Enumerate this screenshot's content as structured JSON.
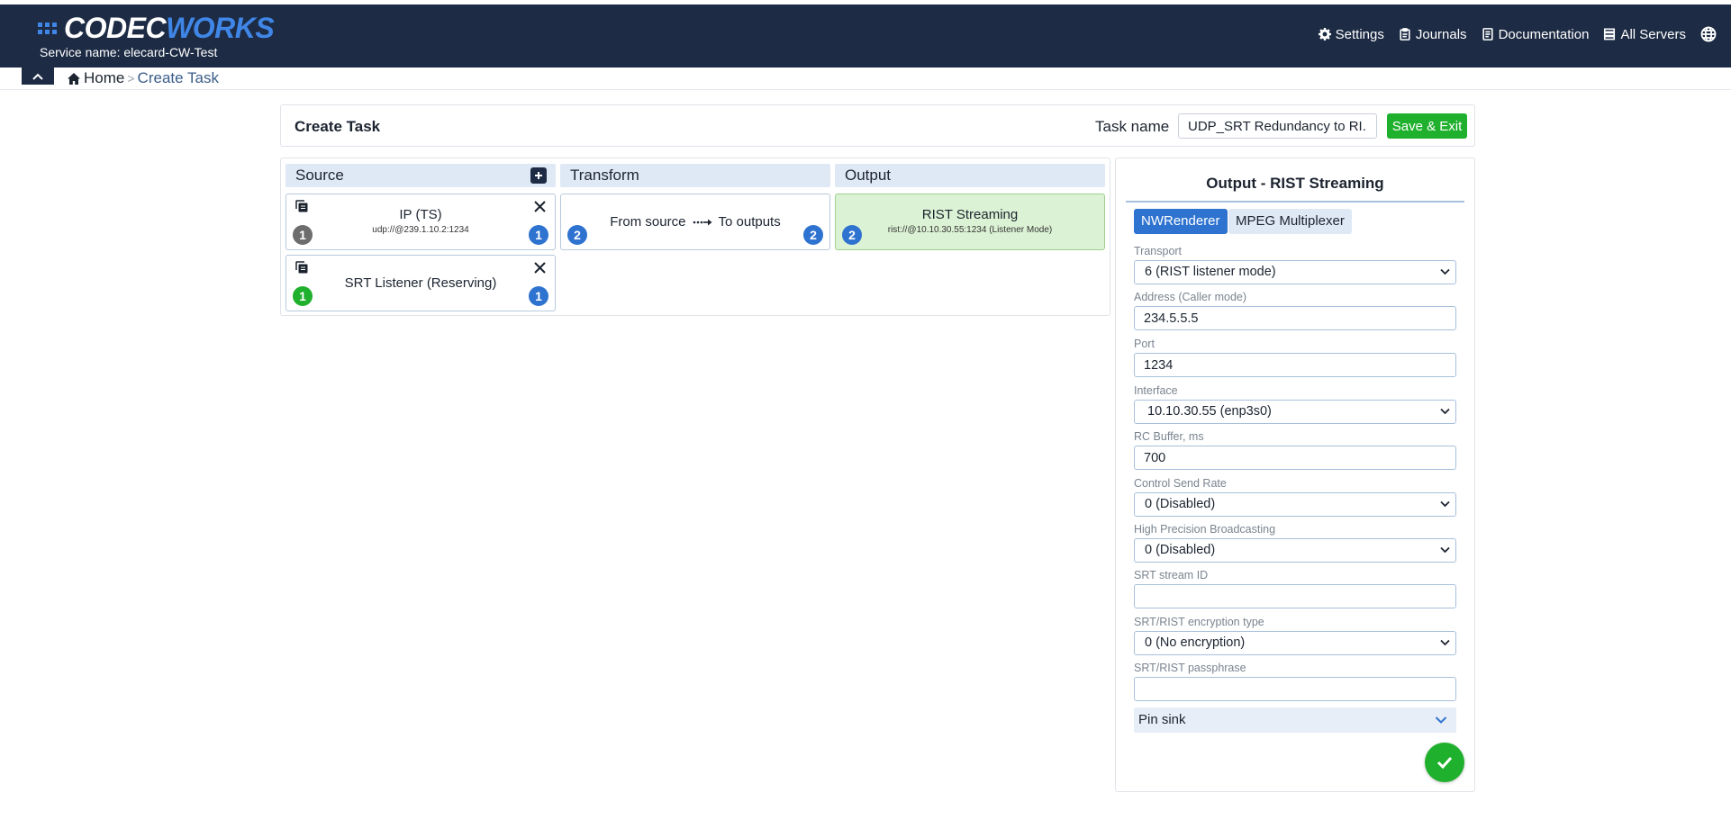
{
  "header": {
    "logo_word1": "CODEC",
    "logo_word2": "WORKS",
    "service_name": "Service name: elecard-CW-Test",
    "nav": {
      "settings": "Settings",
      "journals": "Journals",
      "documentation": "Documentation",
      "all_servers": "All Servers"
    }
  },
  "breadcrumb": {
    "home": "Home",
    "current": "Create Task"
  },
  "task": {
    "title": "Create Task",
    "name_label": "Task name",
    "name_value": "UDP_SRT Redundancy to RI...",
    "save_label": "Save & Exit"
  },
  "pipeline": {
    "source_label": "Source",
    "transform_label": "Transform",
    "output_label": "Output",
    "sources": [
      {
        "title": "IP (TS)",
        "sub": "udp://@239.1.10.2:1234",
        "left_badge": "1",
        "right_badge": "1"
      },
      {
        "title": "SRT Listener (Reserving)",
        "left_badge": "1",
        "right_badge": "1"
      }
    ],
    "transform": {
      "from": "From source",
      "to": "To outputs",
      "left_badge": "2",
      "right_badge": "2"
    },
    "output": {
      "title": "RIST Streaming",
      "sub": "rist://@10.10.30.55:1234 (Listener Mode)",
      "left_badge": "2"
    }
  },
  "panel": {
    "title": "Output - RIST Streaming",
    "tabs": [
      "NWRenderer",
      "MPEG Multiplexer"
    ],
    "fields": {
      "transport": {
        "label": "Transport",
        "value": "6 (RIST listener mode)"
      },
      "address": {
        "label": "Address (Caller mode)",
        "value": "234.5.5.5"
      },
      "port": {
        "label": "Port",
        "value": "1234"
      },
      "interface": {
        "label": "Interface",
        "value": "10.10.30.55 (enp3s0)"
      },
      "rc_buffer": {
        "label": "RC Buffer, ms",
        "value": "700"
      },
      "control_send_rate": {
        "label": "Control Send Rate",
        "value": "0 (Disabled)"
      },
      "high_precision": {
        "label": "High Precision Broadcasting",
        "value": "0 (Disabled)"
      },
      "srt_stream_id": {
        "label": "SRT stream ID",
        "value": ""
      },
      "encryption_type": {
        "label": "SRT/RIST encryption type",
        "value": "0 (No encryption)"
      },
      "passphrase": {
        "label": "SRT/RIST passphrase",
        "value": ""
      }
    },
    "pin_sink": "Pin sink"
  },
  "colors": {
    "navbar": "#1d2b44",
    "accent_blue": "#2f73d0",
    "success_green": "#1fb02d"
  }
}
